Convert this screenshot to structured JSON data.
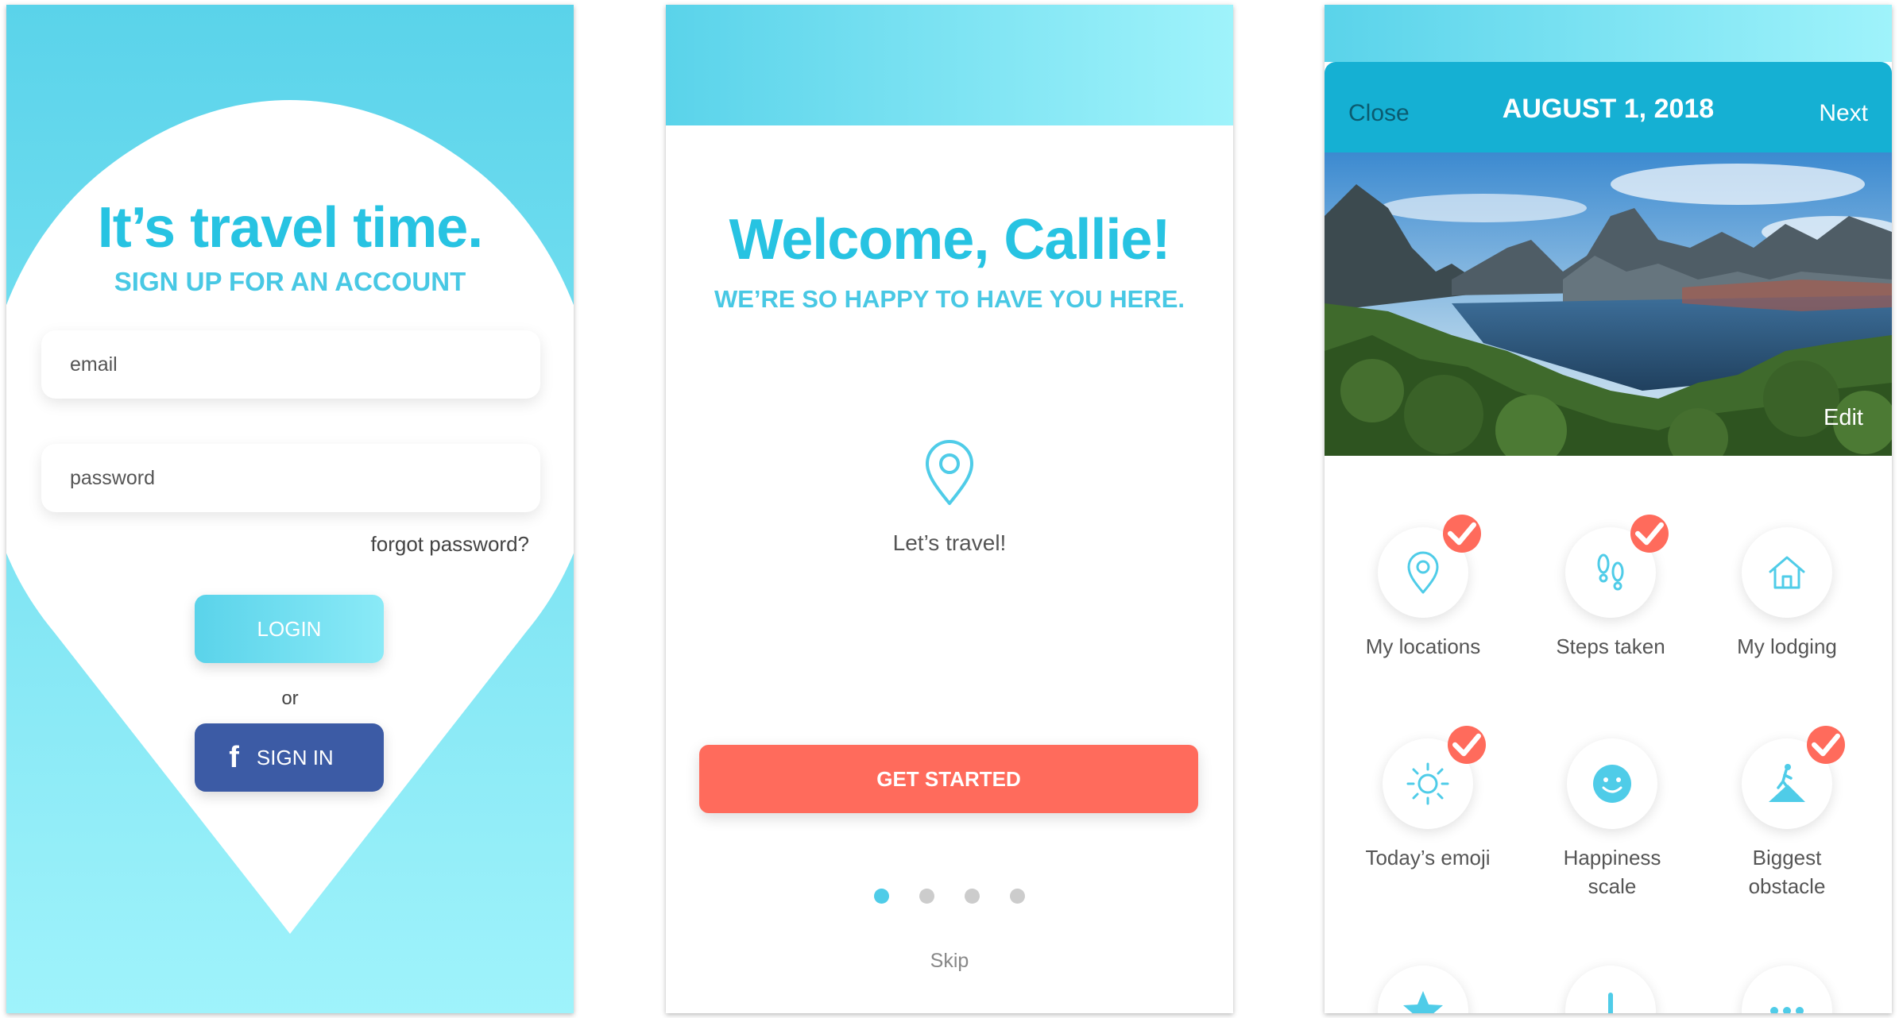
{
  "colors": {
    "accent": "#27c3e2",
    "accent_light": "#9ff3fb",
    "coral": "#ff6b5c",
    "facebook": "#3c5ba5",
    "header_teal": "#15b0d3"
  },
  "login": {
    "title": "It’s travel time.",
    "subtitle": "SIGN UP FOR AN ACCOUNT",
    "email_placeholder": "email",
    "password_placeholder": "password",
    "forgot_label": "forgot password?",
    "login_label": "LOGIN",
    "or_label": "or",
    "facebook_label": "SIGN IN",
    "facebook_icon": "facebook-icon"
  },
  "welcome": {
    "title": "Welcome, Callie!",
    "subtitle": "WE’RE SO HAPPY TO HAVE YOU HERE.",
    "icon": "location-pin-icon",
    "caption": "Let’s travel!",
    "cta_label": "GET STARTED",
    "pager": {
      "total": 4,
      "active": 1
    },
    "skip_label": "Skip"
  },
  "journal": {
    "close_label": "Close",
    "date": "AUGUST 1, 2018",
    "next_label": "Next",
    "edit_label": "Edit",
    "tiles": [
      {
        "label": "My locations",
        "icon": "location-pin-icon",
        "checked": true
      },
      {
        "label": "Steps taken",
        "icon": "footprints-icon",
        "checked": true
      },
      {
        "label": "My lodging",
        "icon": "house-icon",
        "checked": false
      },
      {
        "label": "Today’s emoji",
        "icon": "sun-icon",
        "checked": true
      },
      {
        "label": "Happiness scale",
        "icon": "smiley-icon",
        "checked": false
      },
      {
        "label": "Biggest obstacle",
        "icon": "hiker-icon",
        "checked": true
      },
      {
        "label": "",
        "icon": "star-icon",
        "checked": false
      },
      {
        "label": "",
        "icon": "exclamation-icon",
        "checked": false
      },
      {
        "label": "",
        "icon": "more-icon",
        "checked": false
      }
    ]
  }
}
